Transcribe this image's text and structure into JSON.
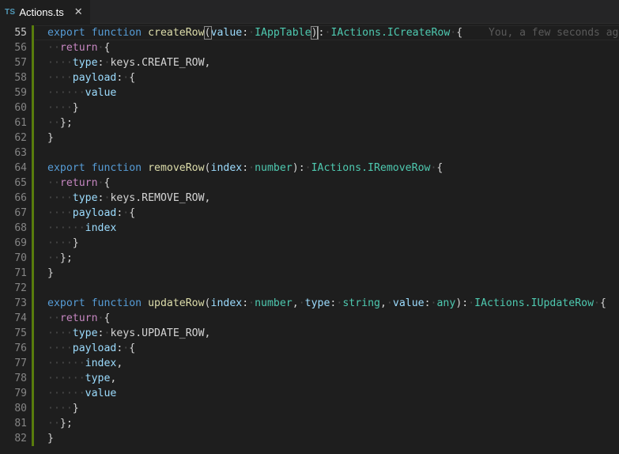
{
  "tab": {
    "icon_label": "TS",
    "filename": "Actions.ts",
    "close_glyph": "✕"
  },
  "blame": "You, a few seconds ago",
  "lines": [
    {
      "num": "55",
      "current": true,
      "tokens": [
        {
          "t": "export",
          "c": "kw"
        },
        {
          "t": " ",
          "c": "ws"
        },
        {
          "t": "function",
          "c": "kw"
        },
        {
          "t": " ",
          "c": "ws"
        },
        {
          "t": "createRow",
          "c": "fn"
        },
        {
          "t": "(",
          "c": "pl",
          "paren": true
        },
        {
          "t": "value",
          "c": "pm"
        },
        {
          "t": ":",
          "c": "pl"
        },
        {
          "t": "·",
          "c": "ws"
        },
        {
          "t": "IAppTable",
          "c": "ty"
        },
        {
          "t": ")",
          "c": "pl",
          "paren": true,
          "cursor": true
        },
        {
          "t": ":",
          "c": "pl"
        },
        {
          "t": "·",
          "c": "ws"
        },
        {
          "t": "IActions.ICreateRow",
          "c": "ty"
        },
        {
          "t": "·",
          "c": "ws"
        },
        {
          "t": "{",
          "c": "pl"
        }
      ]
    },
    {
      "num": "56",
      "tokens": [
        {
          "t": "··",
          "c": "ws"
        },
        {
          "t": "return",
          "c": "ctrl"
        },
        {
          "t": "·",
          "c": "ws"
        },
        {
          "t": "{",
          "c": "pl"
        }
      ]
    },
    {
      "num": "57",
      "tokens": [
        {
          "t": "····",
          "c": "ws"
        },
        {
          "t": "type",
          "c": "pm"
        },
        {
          "t": ":",
          "c": "pl"
        },
        {
          "t": "·",
          "c": "ws"
        },
        {
          "t": "keys.CREATE_ROW,",
          "c": "pl"
        }
      ]
    },
    {
      "num": "58",
      "tokens": [
        {
          "t": "····",
          "c": "ws"
        },
        {
          "t": "payload",
          "c": "pm"
        },
        {
          "t": ":",
          "c": "pl"
        },
        {
          "t": "·",
          "c": "ws"
        },
        {
          "t": "{",
          "c": "pl"
        }
      ]
    },
    {
      "num": "59",
      "tokens": [
        {
          "t": "······",
          "c": "ws"
        },
        {
          "t": "value",
          "c": "pm"
        }
      ]
    },
    {
      "num": "60",
      "tokens": [
        {
          "t": "····",
          "c": "ws"
        },
        {
          "t": "}",
          "c": "pl"
        }
      ]
    },
    {
      "num": "61",
      "tokens": [
        {
          "t": "··",
          "c": "ws"
        },
        {
          "t": "};",
          "c": "pl"
        }
      ]
    },
    {
      "num": "62",
      "tokens": [
        {
          "t": "}",
          "c": "pl"
        }
      ]
    },
    {
      "num": "63",
      "tokens": []
    },
    {
      "num": "64",
      "tokens": [
        {
          "t": "export",
          "c": "kw"
        },
        {
          "t": " ",
          "c": "ws"
        },
        {
          "t": "function",
          "c": "kw"
        },
        {
          "t": " ",
          "c": "ws"
        },
        {
          "t": "removeRow",
          "c": "fn"
        },
        {
          "t": "(",
          "c": "pl"
        },
        {
          "t": "index",
          "c": "pm"
        },
        {
          "t": ":",
          "c": "pl"
        },
        {
          "t": "·",
          "c": "ws"
        },
        {
          "t": "number",
          "c": "ty"
        },
        {
          "t": "):",
          "c": "pl"
        },
        {
          "t": "·",
          "c": "ws"
        },
        {
          "t": "IActions.IRemoveRow",
          "c": "ty"
        },
        {
          "t": "·",
          "c": "ws"
        },
        {
          "t": "{",
          "c": "pl"
        }
      ]
    },
    {
      "num": "65",
      "tokens": [
        {
          "t": "··",
          "c": "ws"
        },
        {
          "t": "return",
          "c": "ctrl"
        },
        {
          "t": "·",
          "c": "ws"
        },
        {
          "t": "{",
          "c": "pl"
        }
      ]
    },
    {
      "num": "66",
      "tokens": [
        {
          "t": "····",
          "c": "ws"
        },
        {
          "t": "type",
          "c": "pm"
        },
        {
          "t": ":",
          "c": "pl"
        },
        {
          "t": "·",
          "c": "ws"
        },
        {
          "t": "keys.REMOVE_ROW,",
          "c": "pl"
        }
      ]
    },
    {
      "num": "67",
      "tokens": [
        {
          "t": "····",
          "c": "ws"
        },
        {
          "t": "payload",
          "c": "pm"
        },
        {
          "t": ":",
          "c": "pl"
        },
        {
          "t": "·",
          "c": "ws"
        },
        {
          "t": "{",
          "c": "pl"
        }
      ]
    },
    {
      "num": "68",
      "tokens": [
        {
          "t": "······",
          "c": "ws"
        },
        {
          "t": "index",
          "c": "pm"
        }
      ]
    },
    {
      "num": "69",
      "tokens": [
        {
          "t": "····",
          "c": "ws"
        },
        {
          "t": "}",
          "c": "pl"
        }
      ]
    },
    {
      "num": "70",
      "tokens": [
        {
          "t": "··",
          "c": "ws"
        },
        {
          "t": "};",
          "c": "pl"
        }
      ]
    },
    {
      "num": "71",
      "tokens": [
        {
          "t": "}",
          "c": "pl"
        }
      ]
    },
    {
      "num": "72",
      "tokens": []
    },
    {
      "num": "73",
      "tokens": [
        {
          "t": "export",
          "c": "kw"
        },
        {
          "t": " ",
          "c": "ws"
        },
        {
          "t": "function",
          "c": "kw"
        },
        {
          "t": " ",
          "c": "ws"
        },
        {
          "t": "updateRow",
          "c": "fn"
        },
        {
          "t": "(",
          "c": "pl"
        },
        {
          "t": "index",
          "c": "pm"
        },
        {
          "t": ":",
          "c": "pl"
        },
        {
          "t": "·",
          "c": "ws"
        },
        {
          "t": "number",
          "c": "ty"
        },
        {
          "t": ",",
          "c": "pl"
        },
        {
          "t": "·",
          "c": "ws"
        },
        {
          "t": "type",
          "c": "pm"
        },
        {
          "t": ":",
          "c": "pl"
        },
        {
          "t": "·",
          "c": "ws"
        },
        {
          "t": "string",
          "c": "ty"
        },
        {
          "t": ",",
          "c": "pl"
        },
        {
          "t": "·",
          "c": "ws"
        },
        {
          "t": "value",
          "c": "pm"
        },
        {
          "t": ":",
          "c": "pl"
        },
        {
          "t": "·",
          "c": "ws"
        },
        {
          "t": "any",
          "c": "ty"
        },
        {
          "t": "):",
          "c": "pl"
        },
        {
          "t": "·",
          "c": "ws"
        },
        {
          "t": "IActions.IUpdateRow",
          "c": "ty"
        },
        {
          "t": "·",
          "c": "ws"
        },
        {
          "t": "{",
          "c": "pl"
        }
      ]
    },
    {
      "num": "74",
      "tokens": [
        {
          "t": "··",
          "c": "ws"
        },
        {
          "t": "return",
          "c": "ctrl"
        },
        {
          "t": "·",
          "c": "ws"
        },
        {
          "t": "{",
          "c": "pl"
        }
      ]
    },
    {
      "num": "75",
      "tokens": [
        {
          "t": "····",
          "c": "ws"
        },
        {
          "t": "type",
          "c": "pm"
        },
        {
          "t": ":",
          "c": "pl"
        },
        {
          "t": "·",
          "c": "ws"
        },
        {
          "t": "keys.UPDATE_ROW,",
          "c": "pl"
        }
      ]
    },
    {
      "num": "76",
      "tokens": [
        {
          "t": "····",
          "c": "ws"
        },
        {
          "t": "payload",
          "c": "pm"
        },
        {
          "t": ":",
          "c": "pl"
        },
        {
          "t": "·",
          "c": "ws"
        },
        {
          "t": "{",
          "c": "pl"
        }
      ]
    },
    {
      "num": "77",
      "tokens": [
        {
          "t": "······",
          "c": "ws"
        },
        {
          "t": "index",
          "c": "pm"
        },
        {
          "t": ",",
          "c": "pl"
        }
      ]
    },
    {
      "num": "78",
      "tokens": [
        {
          "t": "······",
          "c": "ws"
        },
        {
          "t": "type",
          "c": "pm"
        },
        {
          "t": ",",
          "c": "pl"
        }
      ]
    },
    {
      "num": "79",
      "tokens": [
        {
          "t": "······",
          "c": "ws"
        },
        {
          "t": "value",
          "c": "pm"
        }
      ]
    },
    {
      "num": "80",
      "tokens": [
        {
          "t": "····",
          "c": "ws"
        },
        {
          "t": "}",
          "c": "pl"
        }
      ]
    },
    {
      "num": "81",
      "tokens": [
        {
          "t": "··",
          "c": "ws"
        },
        {
          "t": "};",
          "c": "pl"
        }
      ]
    },
    {
      "num": "82",
      "tokens": [
        {
          "t": "}",
          "c": "pl"
        }
      ]
    }
  ]
}
